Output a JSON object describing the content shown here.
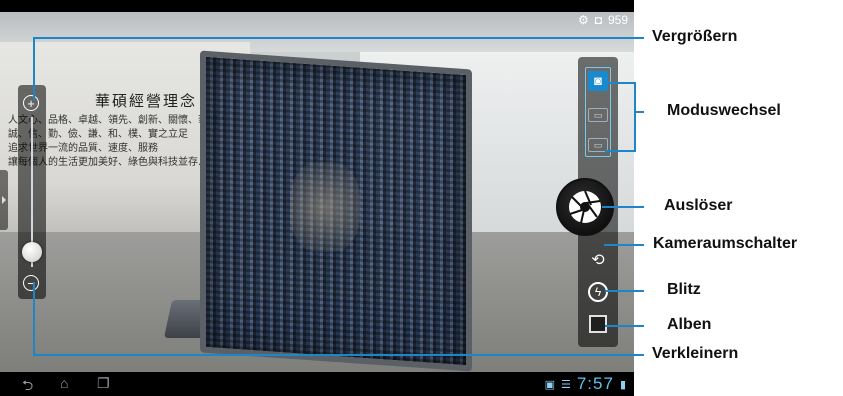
{
  "status_bar": {
    "icons": [
      "settings-icon",
      "camera-icon"
    ],
    "remaining_count": "959"
  },
  "viewfinder": {
    "wall_heading": "華碩經營理念",
    "wall_lines": [
      "人文心、品格、卓越、領先、創新、關懷、華碩人...",
      "誠、信、勤、儉、謙、和、樸、實之立足",
      "追求世界一流的品質、速度、服務",
      "讓每個人的生活更加美好、綠色與科技並存..."
    ]
  },
  "controls": {
    "zoom_level": 0.1,
    "active_mode": "camera"
  },
  "navbar": {
    "time": "7:57",
    "icons": [
      "back-icon",
      "home-icon",
      "recent-apps-icon",
      "gallery-icon",
      "wifi-icon",
      "battery-icon"
    ]
  },
  "callouts": {
    "zoom_in": "Vergrößern",
    "mode_switch": "Moduswechsel",
    "shutter": "Auslöser",
    "camera_switch": "Kameraumschalter",
    "flash": "Blitz",
    "albums": "Alben",
    "zoom_out": "Verkleinern"
  },
  "colors": {
    "callout_line": "#1c86c8",
    "mode_active": "#1a8ad0",
    "clock": "#5ec2ee"
  }
}
